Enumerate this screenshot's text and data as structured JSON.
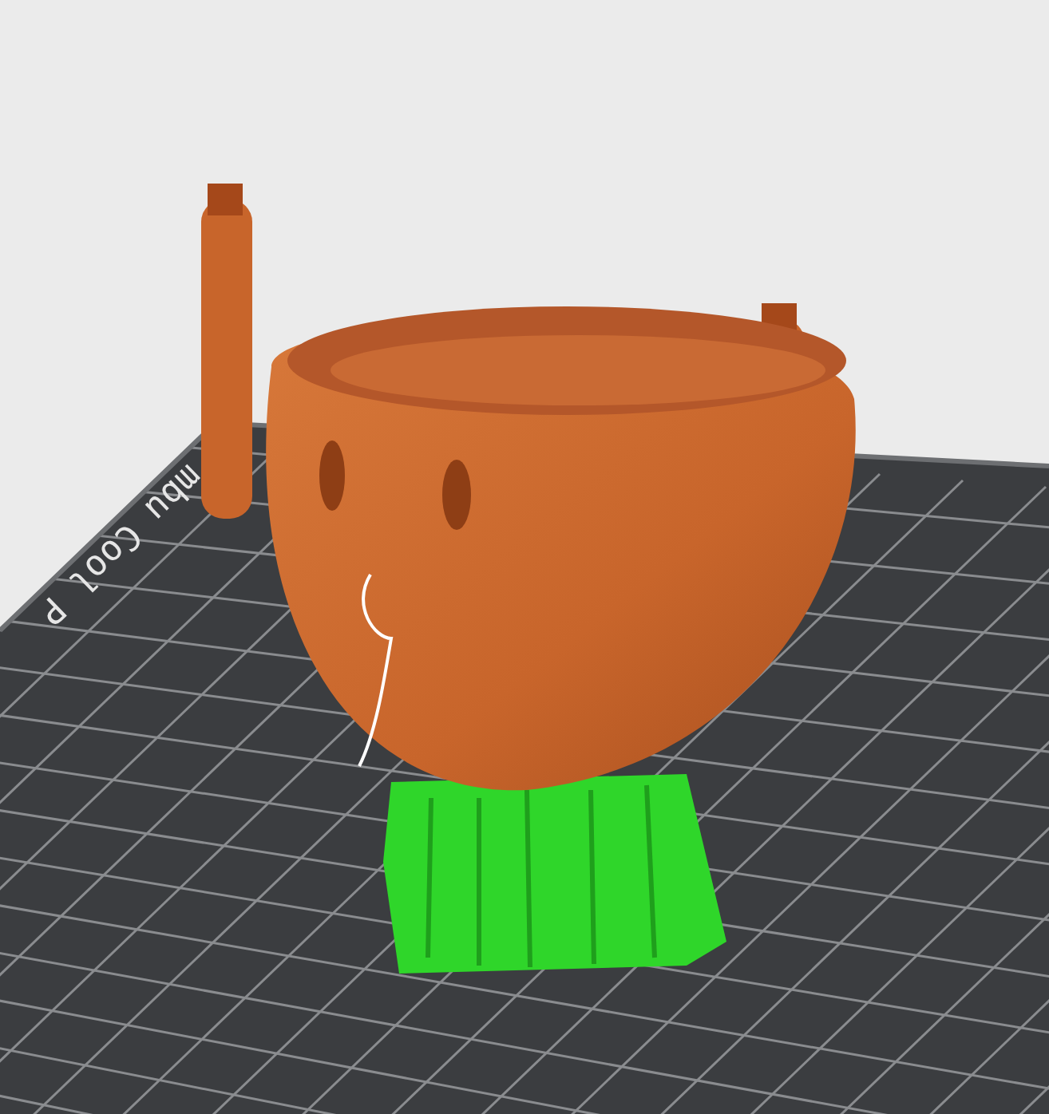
{
  "bed_label": {
    "text": "mbu Cool P"
  }
}
